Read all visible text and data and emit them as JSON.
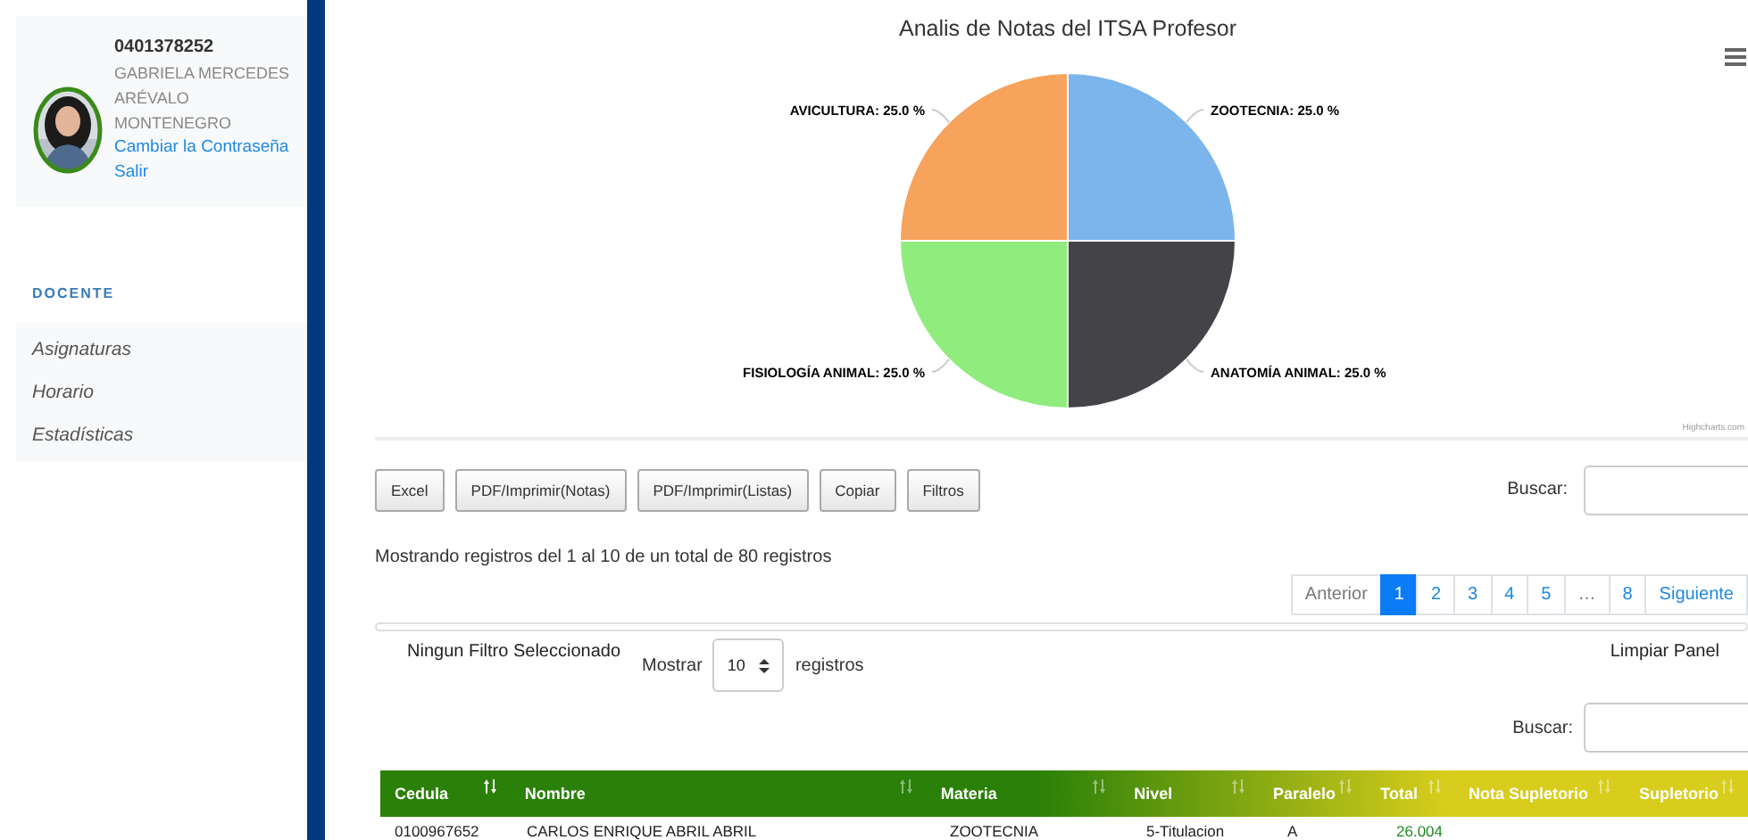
{
  "profile": {
    "id": "0401378252",
    "name": "GABRIELA MERCEDES ARÉVALO MONTENEGRO",
    "links": [
      "Cambiar la Contraseña",
      "Salir"
    ]
  },
  "sidebar": {
    "section": "DOCENTE",
    "items": [
      "Asignaturas",
      "Horario",
      "Estadísticas"
    ]
  },
  "chart": {
    "credit": "Highcharts.com",
    "chart_data": {
      "type": "pie",
      "title": "Analis de Notas del ITSA Profesor",
      "values": [
        25.0,
        25.0,
        25.0,
        25.0
      ],
      "colors": [
        "#7cb5ec",
        "#434348",
        "#90ed7d",
        "#f7a35c"
      ],
      "value_labels": [
        "ZOOTECNIA: 25.0 %",
        "ANATOMÍA ANIMAL: 25.0 %",
        "FISIOLOGÍA ANIMAL: 25.0 %",
        "AVICULTURA: 25.0 %"
      ]
    }
  },
  "toolbar": {
    "buttons": [
      "Excel",
      "PDF/Imprimir(Notas)",
      "PDF/Imprimir(Listas)",
      "Copiar",
      "Filtros"
    ],
    "search_label": "Buscar:"
  },
  "info": "Mostrando registros del 1 al 10 de un total de 80 registros",
  "pagination": [
    {
      "label": "Anterior",
      "selected": false,
      "disabled": true
    },
    {
      "label": "1",
      "selected": true,
      "disabled": false
    },
    {
      "label": "2",
      "selected": false,
      "disabled": false
    },
    {
      "label": "3",
      "selected": false,
      "disabled": false
    },
    {
      "label": "4",
      "selected": false,
      "disabled": false
    },
    {
      "label": "5",
      "selected": false,
      "disabled": false
    },
    {
      "label": "…",
      "selected": false,
      "disabled": true
    },
    {
      "label": "8",
      "selected": false,
      "disabled": false
    },
    {
      "label": "Siguiente",
      "selected": false,
      "disabled": false
    }
  ],
  "filter_panel": {
    "status": "Ningun Filtro Seleccionado",
    "show_label": "Mostrar",
    "show_value": "10",
    "show_suffix": "registros",
    "clear": "Limpiar Panel",
    "search_label": "Buscar:"
  },
  "table": {
    "columns": [
      "Cedula",
      "Nombre",
      "Materia",
      "Nivel",
      "Paralelo",
      "Total",
      "Nota Supletorio",
      "Supletorio"
    ],
    "rows": [
      [
        "0100967652",
        "CARLOS ENRIQUE ABRIL ABRIL",
        "ZOOTECNIA",
        "5-Titulacion",
        "A",
        "26.004"
      ]
    ]
  }
}
